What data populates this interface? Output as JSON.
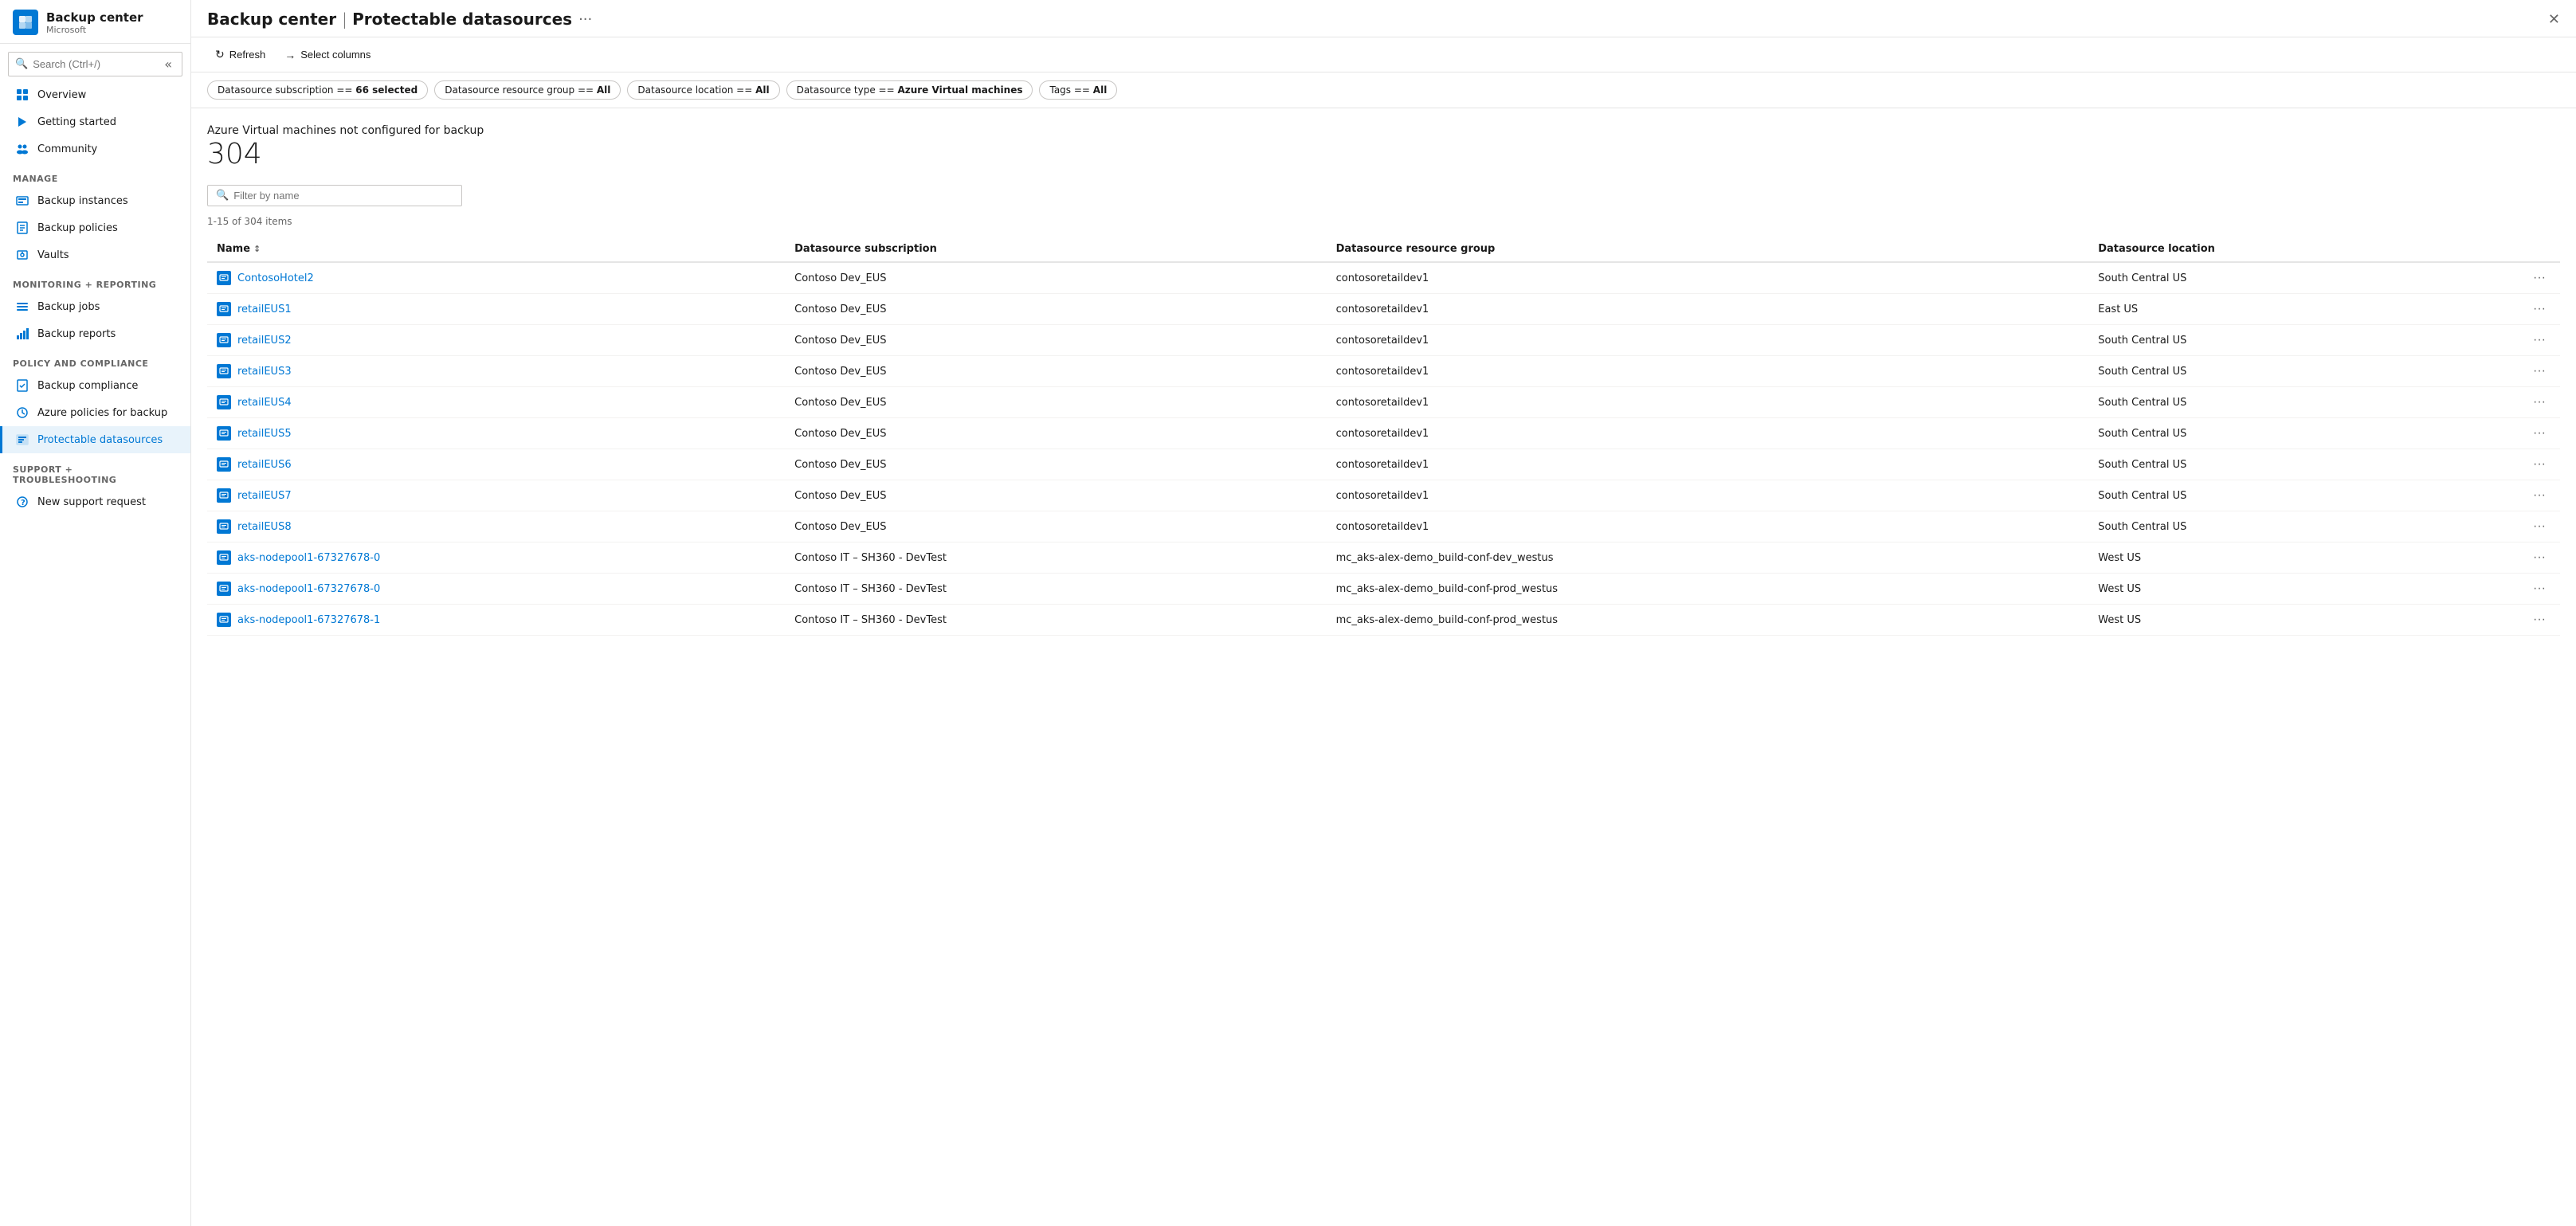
{
  "app": {
    "title": "Backup center",
    "subtitle": "Microsoft",
    "page": "Protectable datasources",
    "icon": "☁"
  },
  "search": {
    "placeholder": "Search (Ctrl+/)"
  },
  "sidebar": {
    "collapse_label": "«",
    "nav_items": [
      {
        "id": "overview",
        "label": "Overview",
        "icon": "⊞",
        "section": null
      },
      {
        "id": "getting-started",
        "label": "Getting started",
        "icon": "▶",
        "section": null
      },
      {
        "id": "community",
        "label": "Community",
        "icon": "👥",
        "section": null
      }
    ],
    "manage_label": "Manage",
    "manage_items": [
      {
        "id": "backup-instances",
        "label": "Backup instances",
        "icon": "🗄"
      },
      {
        "id": "backup-policies",
        "label": "Backup policies",
        "icon": "📋"
      },
      {
        "id": "vaults",
        "label": "Vaults",
        "icon": "🔒"
      }
    ],
    "monitoring_label": "Monitoring + reporting",
    "monitoring_items": [
      {
        "id": "backup-jobs",
        "label": "Backup jobs",
        "icon": "≡"
      },
      {
        "id": "backup-reports",
        "label": "Backup reports",
        "icon": "📊"
      }
    ],
    "policy_label": "Policy and compliance",
    "policy_items": [
      {
        "id": "backup-compliance",
        "label": "Backup compliance",
        "icon": "📄"
      },
      {
        "id": "azure-policies",
        "label": "Azure policies for backup",
        "icon": "🔧"
      },
      {
        "id": "protectable-datasources",
        "label": "Protectable datasources",
        "icon": "🗃",
        "active": true
      }
    ],
    "support_label": "Support + troubleshooting",
    "support_items": [
      {
        "id": "new-support-request",
        "label": "New support request",
        "icon": "❓"
      }
    ]
  },
  "toolbar": {
    "refresh_label": "Refresh",
    "select_columns_label": "Select columns"
  },
  "filters": [
    {
      "id": "subscription",
      "label": "Datasource subscription == ",
      "value": "66 selected"
    },
    {
      "id": "resource-group",
      "label": "Datasource resource group == ",
      "value": "All"
    },
    {
      "id": "location",
      "label": "Datasource location == ",
      "value": "All"
    },
    {
      "id": "type",
      "label": "Datasource type == ",
      "value": "Azure Virtual machines"
    },
    {
      "id": "tags",
      "label": "Tags == ",
      "value": "All"
    }
  ],
  "summary": {
    "title": "Azure Virtual machines not configured for backup",
    "count": "304"
  },
  "filter_input": {
    "placeholder": "Filter by name"
  },
  "items_count": "1-15 of 304 items",
  "columns": [
    {
      "id": "name",
      "label": "Name",
      "sortable": true
    },
    {
      "id": "subscription",
      "label": "Datasource subscription",
      "sortable": false
    },
    {
      "id": "resource-group",
      "label": "Datasource resource group",
      "sortable": false
    },
    {
      "id": "location",
      "label": "Datasource location",
      "sortable": false
    }
  ],
  "rows": [
    {
      "name": "ContosoHotel2",
      "subscription": "Contoso Dev_EUS",
      "resource_group": "contosoretaildev1",
      "location": "South Central US"
    },
    {
      "name": "retailEUS1",
      "subscription": "Contoso Dev_EUS",
      "resource_group": "contosoretaildev1",
      "location": "East US"
    },
    {
      "name": "retailEUS2",
      "subscription": "Contoso Dev_EUS",
      "resource_group": "contosoretaildev1",
      "location": "South Central US"
    },
    {
      "name": "retailEUS3",
      "subscription": "Contoso Dev_EUS",
      "resource_group": "contosoretaildev1",
      "location": "South Central US"
    },
    {
      "name": "retailEUS4",
      "subscription": "Contoso Dev_EUS",
      "resource_group": "contosoretaildev1",
      "location": "South Central US"
    },
    {
      "name": "retailEUS5",
      "subscription": "Contoso Dev_EUS",
      "resource_group": "contosoretaildev1",
      "location": "South Central US"
    },
    {
      "name": "retailEUS6",
      "subscription": "Contoso Dev_EUS",
      "resource_group": "contosoretaildev1",
      "location": "South Central US"
    },
    {
      "name": "retailEUS7",
      "subscription": "Contoso Dev_EUS",
      "resource_group": "contosoretaildev1",
      "location": "South Central US"
    },
    {
      "name": "retailEUS8",
      "subscription": "Contoso Dev_EUS",
      "resource_group": "contosoretaildev1",
      "location": "South Central US"
    },
    {
      "name": "aks-nodepool1-67327678-0",
      "subscription": "Contoso IT – SH360 - DevTest",
      "resource_group": "mc_aks-alex-demo_build-conf-dev_westus",
      "location": "West US"
    },
    {
      "name": "aks-nodepool1-67327678-0",
      "subscription": "Contoso IT – SH360 - DevTest",
      "resource_group": "mc_aks-alex-demo_build-conf-prod_westus",
      "location": "West US"
    },
    {
      "name": "aks-nodepool1-67327678-1",
      "subscription": "Contoso IT – SH360 - DevTest",
      "resource_group": "mc_aks-alex-demo_build-conf-prod_westus",
      "location": "West US"
    }
  ]
}
